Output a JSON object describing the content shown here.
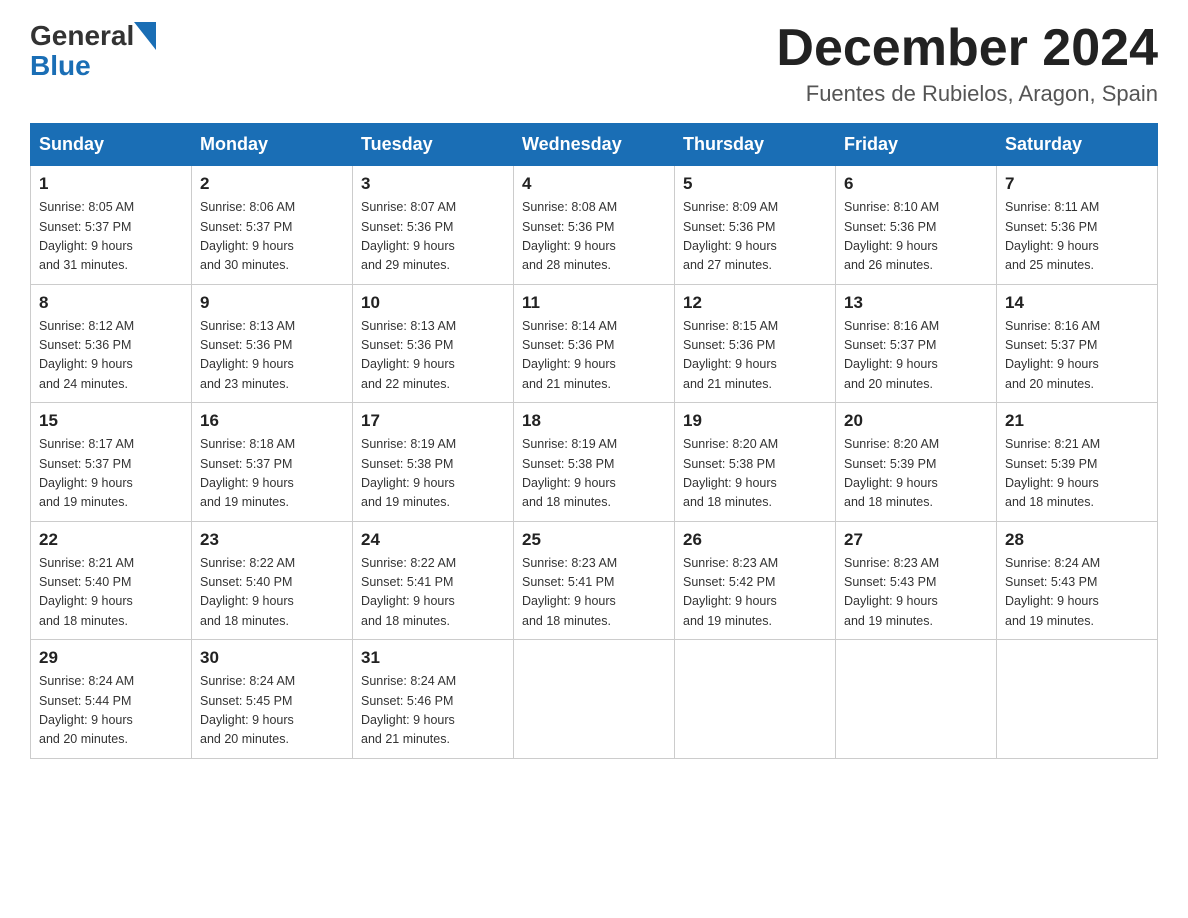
{
  "logo": {
    "general": "General",
    "blue": "Blue"
  },
  "title": "December 2024",
  "location": "Fuentes de Rubielos, Aragon, Spain",
  "days_of_week": [
    "Sunday",
    "Monday",
    "Tuesday",
    "Wednesday",
    "Thursday",
    "Friday",
    "Saturday"
  ],
  "weeks": [
    [
      {
        "day": "1",
        "sunrise": "8:05 AM",
        "sunset": "5:37 PM",
        "daylight": "9 hours and 31 minutes."
      },
      {
        "day": "2",
        "sunrise": "8:06 AM",
        "sunset": "5:37 PM",
        "daylight": "9 hours and 30 minutes."
      },
      {
        "day": "3",
        "sunrise": "8:07 AM",
        "sunset": "5:36 PM",
        "daylight": "9 hours and 29 minutes."
      },
      {
        "day": "4",
        "sunrise": "8:08 AM",
        "sunset": "5:36 PM",
        "daylight": "9 hours and 28 minutes."
      },
      {
        "day": "5",
        "sunrise": "8:09 AM",
        "sunset": "5:36 PM",
        "daylight": "9 hours and 27 minutes."
      },
      {
        "day": "6",
        "sunrise": "8:10 AM",
        "sunset": "5:36 PM",
        "daylight": "9 hours and 26 minutes."
      },
      {
        "day": "7",
        "sunrise": "8:11 AM",
        "sunset": "5:36 PM",
        "daylight": "9 hours and 25 minutes."
      }
    ],
    [
      {
        "day": "8",
        "sunrise": "8:12 AM",
        "sunset": "5:36 PM",
        "daylight": "9 hours and 24 minutes."
      },
      {
        "day": "9",
        "sunrise": "8:13 AM",
        "sunset": "5:36 PM",
        "daylight": "9 hours and 23 minutes."
      },
      {
        "day": "10",
        "sunrise": "8:13 AM",
        "sunset": "5:36 PM",
        "daylight": "9 hours and 22 minutes."
      },
      {
        "day": "11",
        "sunrise": "8:14 AM",
        "sunset": "5:36 PM",
        "daylight": "9 hours and 21 minutes."
      },
      {
        "day": "12",
        "sunrise": "8:15 AM",
        "sunset": "5:36 PM",
        "daylight": "9 hours and 21 minutes."
      },
      {
        "day": "13",
        "sunrise": "8:16 AM",
        "sunset": "5:37 PM",
        "daylight": "9 hours and 20 minutes."
      },
      {
        "day": "14",
        "sunrise": "8:16 AM",
        "sunset": "5:37 PM",
        "daylight": "9 hours and 20 minutes."
      }
    ],
    [
      {
        "day": "15",
        "sunrise": "8:17 AM",
        "sunset": "5:37 PM",
        "daylight": "9 hours and 19 minutes."
      },
      {
        "day": "16",
        "sunrise": "8:18 AM",
        "sunset": "5:37 PM",
        "daylight": "9 hours and 19 minutes."
      },
      {
        "day": "17",
        "sunrise": "8:19 AM",
        "sunset": "5:38 PM",
        "daylight": "9 hours and 19 minutes."
      },
      {
        "day": "18",
        "sunrise": "8:19 AM",
        "sunset": "5:38 PM",
        "daylight": "9 hours and 18 minutes."
      },
      {
        "day": "19",
        "sunrise": "8:20 AM",
        "sunset": "5:38 PM",
        "daylight": "9 hours and 18 minutes."
      },
      {
        "day": "20",
        "sunrise": "8:20 AM",
        "sunset": "5:39 PM",
        "daylight": "9 hours and 18 minutes."
      },
      {
        "day": "21",
        "sunrise": "8:21 AM",
        "sunset": "5:39 PM",
        "daylight": "9 hours and 18 minutes."
      }
    ],
    [
      {
        "day": "22",
        "sunrise": "8:21 AM",
        "sunset": "5:40 PM",
        "daylight": "9 hours and 18 minutes."
      },
      {
        "day": "23",
        "sunrise": "8:22 AM",
        "sunset": "5:40 PM",
        "daylight": "9 hours and 18 minutes."
      },
      {
        "day": "24",
        "sunrise": "8:22 AM",
        "sunset": "5:41 PM",
        "daylight": "9 hours and 18 minutes."
      },
      {
        "day": "25",
        "sunrise": "8:23 AM",
        "sunset": "5:41 PM",
        "daylight": "9 hours and 18 minutes."
      },
      {
        "day": "26",
        "sunrise": "8:23 AM",
        "sunset": "5:42 PM",
        "daylight": "9 hours and 19 minutes."
      },
      {
        "day": "27",
        "sunrise": "8:23 AM",
        "sunset": "5:43 PM",
        "daylight": "9 hours and 19 minutes."
      },
      {
        "day": "28",
        "sunrise": "8:24 AM",
        "sunset": "5:43 PM",
        "daylight": "9 hours and 19 minutes."
      }
    ],
    [
      {
        "day": "29",
        "sunrise": "8:24 AM",
        "sunset": "5:44 PM",
        "daylight": "9 hours and 20 minutes."
      },
      {
        "day": "30",
        "sunrise": "8:24 AM",
        "sunset": "5:45 PM",
        "daylight": "9 hours and 20 minutes."
      },
      {
        "day": "31",
        "sunrise": "8:24 AM",
        "sunset": "5:46 PM",
        "daylight": "9 hours and 21 minutes."
      },
      null,
      null,
      null,
      null
    ]
  ],
  "labels": {
    "sunrise": "Sunrise:",
    "sunset": "Sunset:",
    "daylight": "Daylight:"
  },
  "colors": {
    "header_bg": "#1a6eb5",
    "header_text": "#ffffff",
    "border": "#cccccc"
  }
}
